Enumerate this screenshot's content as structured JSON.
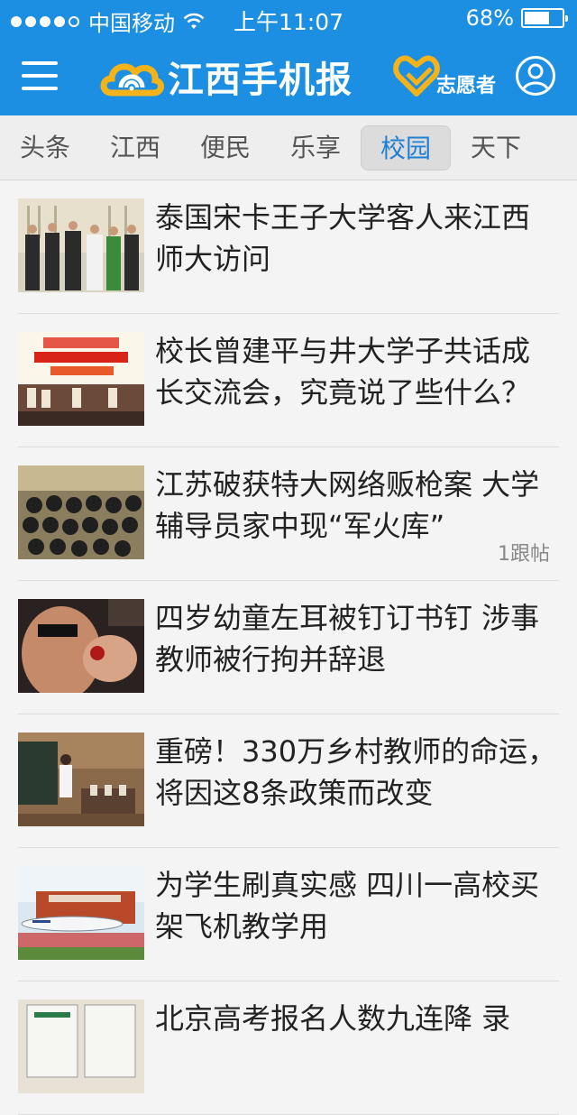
{
  "status_bar": {
    "carrier": "中国移动",
    "time": "上午11:07",
    "battery": "68%",
    "battery_level": 0.68
  },
  "header": {
    "logo_text": "江西手机报",
    "volunteer_label": "志愿者"
  },
  "tabs": [
    {
      "label": "头条",
      "active": false
    },
    {
      "label": "江西",
      "active": false
    },
    {
      "label": "便民",
      "active": false
    },
    {
      "label": "乐享",
      "active": false
    },
    {
      "label": "校园",
      "active": true
    },
    {
      "label": "天下",
      "active": false
    }
  ],
  "news": [
    {
      "title": "泰国宋卡王子大学客人来江西师大访问",
      "replies": ""
    },
    {
      "title": "校长曾建平与井大学子共话成长交流会，究竟说了些什么？",
      "replies": ""
    },
    {
      "title": "江苏破获特大网络贩枪案 大学辅导员家中现“军火库”",
      "replies": "1跟帖"
    },
    {
      "title": "四岁幼童左耳被钉订书钉 涉事教师被行拘并辞退",
      "replies": ""
    },
    {
      "title": "重磅！330万乡村教师的命运，将因这8条政策而改变",
      "replies": ""
    },
    {
      "title": "为学生刷真实感 四川一高校买架飞机教学用",
      "replies": ""
    },
    {
      "title": "北京高考报名人数九连降 录",
      "replies": ""
    }
  ],
  "colors": {
    "header_bg": "#1c8fe2",
    "active_tab_text": "#1e7fd3",
    "logo_yellow": "#f5b31b"
  }
}
